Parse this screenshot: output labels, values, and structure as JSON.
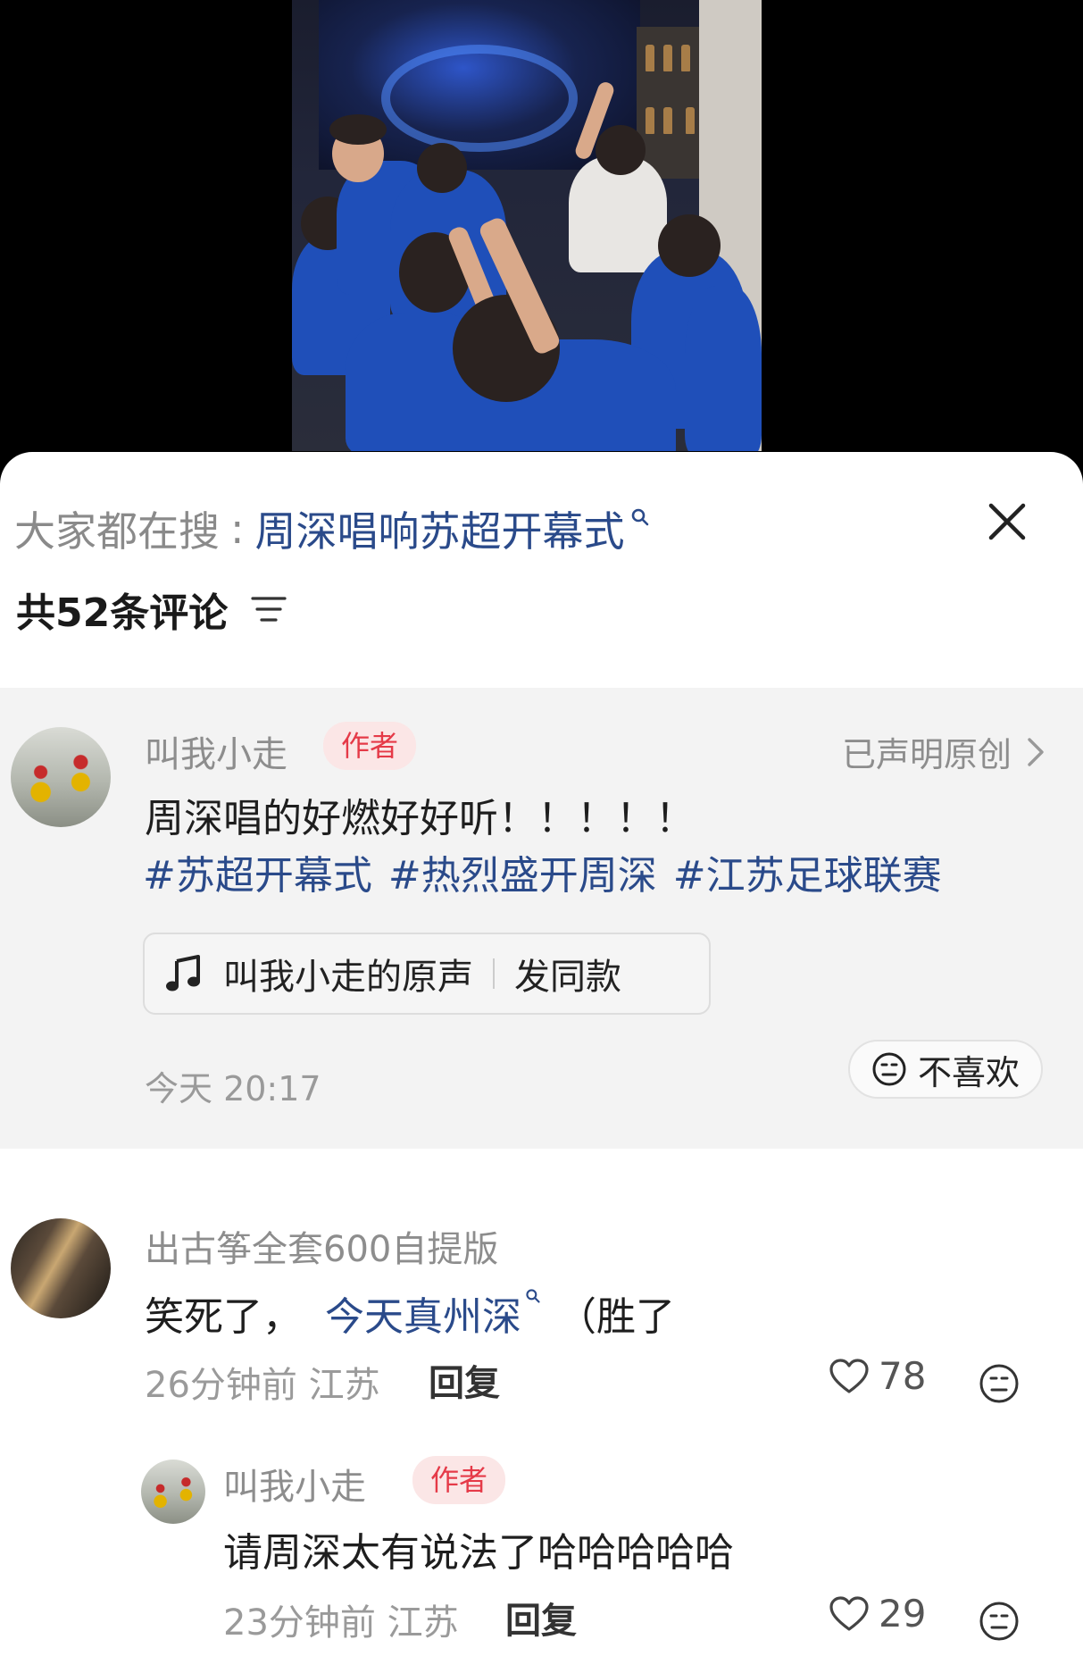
{
  "search": {
    "prefix": "大家都在搜",
    "colon": ":",
    "term": "周深唱响苏超开幕式"
  },
  "comments_header": {
    "count_label": "共52条评论"
  },
  "author_comment": {
    "username": "叫我小走",
    "tag": "作者",
    "original_label": "已声明原创",
    "text": "周深唱的好燃好好听！！！！！",
    "hashtags": [
      "#苏超开幕式",
      "#热烈盛开周深",
      "#江苏足球联赛"
    ],
    "sound_name": "叫我小走的原声",
    "same_style_label": "发同款",
    "time": "今天 20:17",
    "dislike_label": "不喜欢"
  },
  "comment_1": {
    "username": "出古筝全套600自提版",
    "text_before": "笑死了，",
    "link_text": "今天真州深",
    "text_after": "（胜了",
    "meta": "26分钟前 江苏",
    "reply_label": "回复",
    "likes": "78"
  },
  "reply_1": {
    "username": "叫我小走",
    "tag": "作者",
    "text": "请周深太有说法了哈哈哈哈哈",
    "meta": "23分钟前 江苏",
    "reply_label": "回复",
    "likes": "29"
  },
  "icons": {
    "close": "close-icon",
    "search": "search-icon",
    "sort": "sort-icon",
    "music": "music-note-icon",
    "chevron": "chevron-right-icon",
    "like": "heart-icon",
    "dislike": "meh-face-icon"
  },
  "colors": {
    "link_blue": "#2a4a8a",
    "author_tag_bg": "#fbe6e6",
    "author_tag_text": "#e53a48",
    "author_block_bg": "#f3f3f3"
  }
}
